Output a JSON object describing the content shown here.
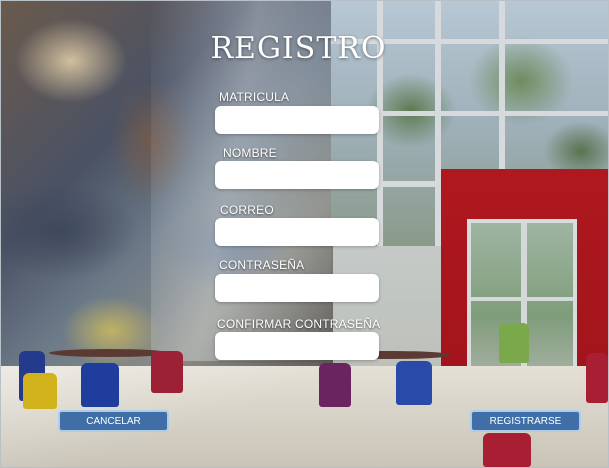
{
  "form": {
    "title": "REGISTRO",
    "fields": [
      {
        "label": "MATRICULA",
        "value": ""
      },
      {
        "label": "NOMBRE",
        "value": ""
      },
      {
        "label": "CORREO",
        "value": ""
      },
      {
        "label": "CONTRASEÑA",
        "value": ""
      },
      {
        "label": "CONFIRMAR CONTRASEÑA",
        "value": ""
      }
    ],
    "cancel_label": "CANCELAR",
    "submit_label": "REGISTRARSE"
  },
  "colors": {
    "button_bg": "#3f6fa6",
    "button_border": "#aecbe8",
    "wall_red": "#b0181f"
  }
}
